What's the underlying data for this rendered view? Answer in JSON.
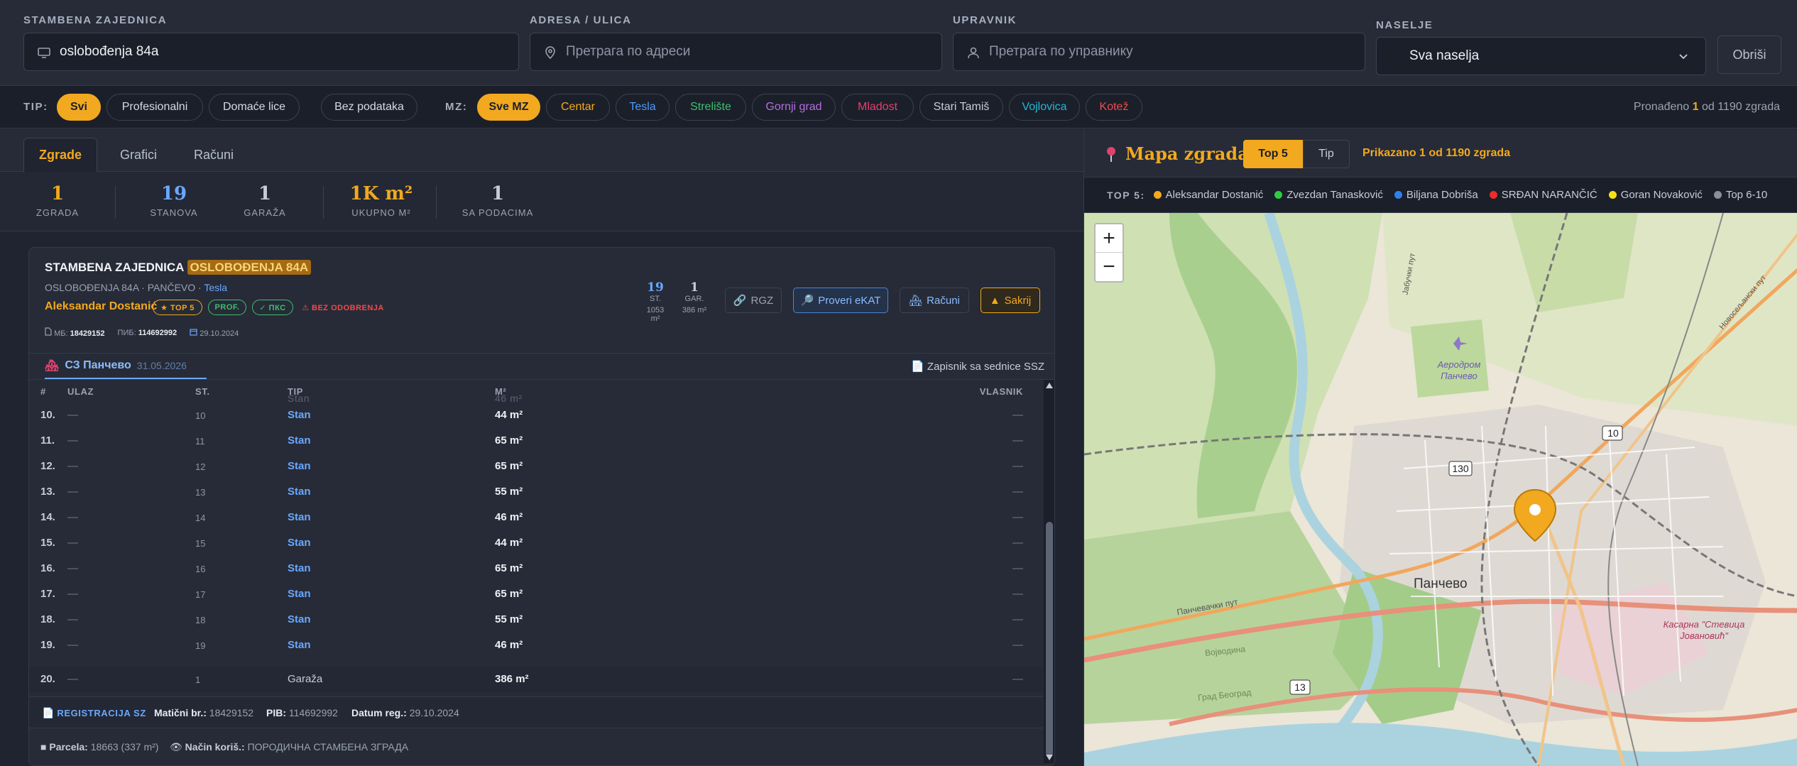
{
  "search": {
    "community_label": "STAMBENA ZAJEDNICA",
    "community_value": "oslobođenja 84a",
    "address_label": "ADRESA / ULICA",
    "address_placeholder": "Претрага по адреси",
    "manager_label": "UPRAVNIK",
    "manager_placeholder": "Претрага по управнику",
    "settlement_label": "NASELJE",
    "settlement_value": "Sva naselja",
    "clear_label": "Obriši"
  },
  "filters": {
    "tip_label": "TIP:",
    "tip_chips": [
      "Svi",
      "Profesionalni",
      "Domaće lice",
      "Bez podataka"
    ],
    "mz_label": "MZ:",
    "mz_chips": [
      {
        "label": "Sve MZ",
        "color": "#1b1f29"
      },
      {
        "label": "Centar",
        "color": "#f2a91f"
      },
      {
        "label": "Tesla",
        "color": "#4c9bff"
      },
      {
        "label": "Strelište",
        "color": "#3fbf73"
      },
      {
        "label": "Gornji grad",
        "color": "#b36ee0"
      },
      {
        "label": "Mladost",
        "color": "#e0426e"
      },
      {
        "label": "Stari Tamiš",
        "color": "#c7ccd6"
      },
      {
        "label": "Vojlovica",
        "color": "#22b8d6"
      },
      {
        "label": "Kotež",
        "color": "#ef4c4c"
      }
    ],
    "found_prefix": "Pronađeno ",
    "found_count": "1",
    "found_suffix": " od 1190 zgrada"
  },
  "tabs": [
    "Zgrade",
    "Grafici",
    "Računi"
  ],
  "stats": [
    {
      "value": "1",
      "label": "ZGRADA"
    },
    {
      "value": "19",
      "label": "STANOVA"
    },
    {
      "value": "1",
      "label": "GARAŽA"
    },
    {
      "value": "1K m²",
      "label": "UKUPNO M²"
    },
    {
      "value": "1",
      "label": "SA PODACIMA"
    }
  ],
  "card": {
    "title_prefix": "STAMBENA ZAJEDNICA ",
    "title_highlight": "OSLOBOĐENJA 84A",
    "address": "OSLOBOĐENJA 84A · PANČEVO · ",
    "mz": "Tesla",
    "manager": "Aleksandar Dostanić",
    "badge_top": "★ TOP 5",
    "badge_prof": "PROF.",
    "badge_pks": "✓ ПКС",
    "badge_noapp": "⚠ BEZ ODOBRENJA",
    "mb_label": "МБ:",
    "mb": "18429152",
    "pib_label": "ПИБ:",
    "pib": "114692992",
    "date": "29.10.2024",
    "st_value": "19",
    "st_label": "ST.",
    "st_sub": "1053 m²",
    "gar_value": "1",
    "gar_label": "GAR.",
    "gar_sub": "386 m²",
    "btn_rgz": "RGZ",
    "btn_ekat": "Proveri eKAT",
    "btn_racuni": "Računi",
    "btn_sakrij": "Sakrij",
    "subtab_label": "СЗ Панчево",
    "subtab_date": "31.05.2026",
    "zapisnik": "Zapisnik sa sednice SSZ"
  },
  "table": {
    "headers": {
      "num": "#",
      "ulaz": "ULAZ",
      "st": "ST.",
      "tip": "TIP",
      "m2": "M²",
      "vlasnik": "VLASNIK"
    },
    "ghost_tip": "Stan",
    "ghost_m2": "46 m²",
    "rows": [
      {
        "num": "10.",
        "ulaz": "—",
        "st": "10",
        "tip": "Stan",
        "m2": "44 m²",
        "vl": "—"
      },
      {
        "num": "11.",
        "ulaz": "—",
        "st": "11",
        "tip": "Stan",
        "m2": "65 m²",
        "vl": "—"
      },
      {
        "num": "12.",
        "ulaz": "—",
        "st": "12",
        "tip": "Stan",
        "m2": "65 m²",
        "vl": "—"
      },
      {
        "num": "13.",
        "ulaz": "—",
        "st": "13",
        "tip": "Stan",
        "m2": "55 m²",
        "vl": "—"
      },
      {
        "num": "14.",
        "ulaz": "—",
        "st": "14",
        "tip": "Stan",
        "m2": "46 m²",
        "vl": "—"
      },
      {
        "num": "15.",
        "ulaz": "—",
        "st": "15",
        "tip": "Stan",
        "m2": "44 m²",
        "vl": "—"
      },
      {
        "num": "16.",
        "ulaz": "—",
        "st": "16",
        "tip": "Stan",
        "m2": "65 m²",
        "vl": "—"
      },
      {
        "num": "17.",
        "ulaz": "—",
        "st": "17",
        "tip": "Stan",
        "m2": "65 m²",
        "vl": "—"
      },
      {
        "num": "18.",
        "ulaz": "—",
        "st": "18",
        "tip": "Stan",
        "m2": "55 m²",
        "vl": "—"
      },
      {
        "num": "19.",
        "ulaz": "—",
        "st": "19",
        "tip": "Stan",
        "m2": "46 m²",
        "vl": "—"
      }
    ],
    "garage_row": {
      "num": "20.",
      "ulaz": "—",
      "st": "1",
      "tip": "Garaža",
      "m2": "386 m²",
      "vl": "—"
    }
  },
  "registration": {
    "title": "REGISTRACIJA SZ",
    "mb_label": "Matični br.:",
    "mb": "18429152",
    "pib_label": "PIB:",
    "pib": "114692992",
    "date_label": "Datum reg.:",
    "date": "29.10.2024",
    "parcel_label": "Parcela:",
    "parcel": "18663 (337 m²)",
    "use_label": "Način koriš.:",
    "use": "ПОРОДИЧНА СТАМБЕНА ЗГРАДА"
  },
  "map": {
    "title": "Mapa zgrada",
    "tab_top5": "Top 5",
    "tab_tip": "Tip",
    "shown": "Prikazano 1 od 1190 zgrada",
    "legend_title": "TOP 5:",
    "legend": [
      {
        "name": "Aleksandar Dostanić",
        "color": "#f2a91f"
      },
      {
        "name": "Zvezdan Tanasković",
        "color": "#2ecc40"
      },
      {
        "name": "Biljana Dobriša",
        "color": "#2f80ed"
      },
      {
        "name": "SRĐAN NARANČIĆ",
        "color": "#ef2b2b"
      },
      {
        "name": "Goran Novaković",
        "color": "#f5e015"
      },
      {
        "name": "Top 6-10",
        "color": "#8a8f99"
      }
    ],
    "zoom_in": "+",
    "zoom_out": "−",
    "labels": {
      "city": "Панчево",
      "airport": "Аеродром Панчево",
      "kasarna": "Касарна \"Стевица Јовановић\"",
      "road_10": "10",
      "road_130": "130",
      "road_13": "13",
      "street_1": "Панчевачки пут",
      "street_2": "Војводина",
      "street_3": "Град Београд",
      "street_4": "Јабучки пут",
      "street_5": "Новосељански пут"
    }
  }
}
